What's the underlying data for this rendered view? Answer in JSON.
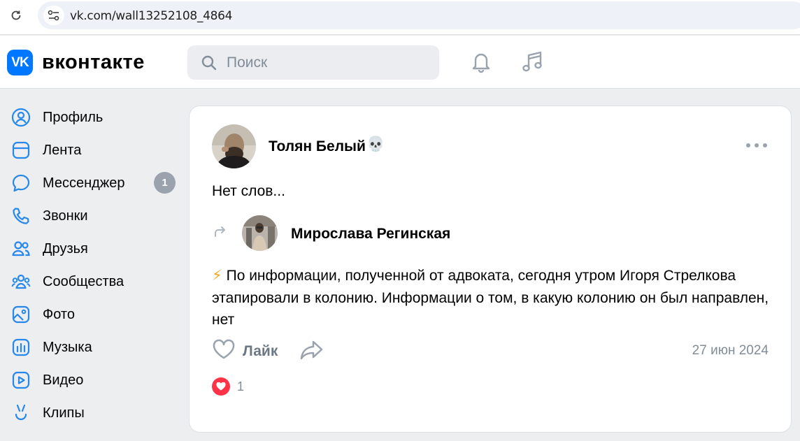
{
  "browser": {
    "url": "vk.com/wall13252108_4864"
  },
  "header": {
    "logo_mark": "VK",
    "logo_text": "вконтакте",
    "search_placeholder": "Поиск",
    "icons": [
      "bell-icon",
      "music-note-icon"
    ]
  },
  "sidebar": {
    "items": [
      {
        "label": "Профиль",
        "icon": "profile-icon"
      },
      {
        "label": "Лента",
        "icon": "feed-icon"
      },
      {
        "label": "Мессенджер",
        "icon": "messenger-icon",
        "badge": "1"
      },
      {
        "label": "Звонки",
        "icon": "phone-icon"
      },
      {
        "label": "Друзья",
        "icon": "friends-icon"
      },
      {
        "label": "Сообщества",
        "icon": "communities-icon"
      },
      {
        "label": "Фото",
        "icon": "photo-icon"
      },
      {
        "label": "Музыка",
        "icon": "music-icon"
      },
      {
        "label": "Видео",
        "icon": "video-icon"
      },
      {
        "label": "Клипы",
        "icon": "clips-icon"
      }
    ]
  },
  "post": {
    "author": "Толян Белый",
    "author_emoji": "💀",
    "text": "Нет слов...",
    "repost": {
      "author": "Мирослава Регинская",
      "emoji": "⚡",
      "text": "По информации, полученной от адвоката, сегодня утром Игоря Стрелкова этапировали в колонию. Информации о том, в какую колонию он был направлен, нет"
    },
    "like_label": "Лайк",
    "date": "27 июн 2024",
    "reactions_count": "1"
  },
  "colors": {
    "accent": "#0077ff",
    "background": "#edeef0",
    "secondary_text": "#818c99",
    "icon": "#2688eb",
    "reaction": "#ff3347"
  }
}
